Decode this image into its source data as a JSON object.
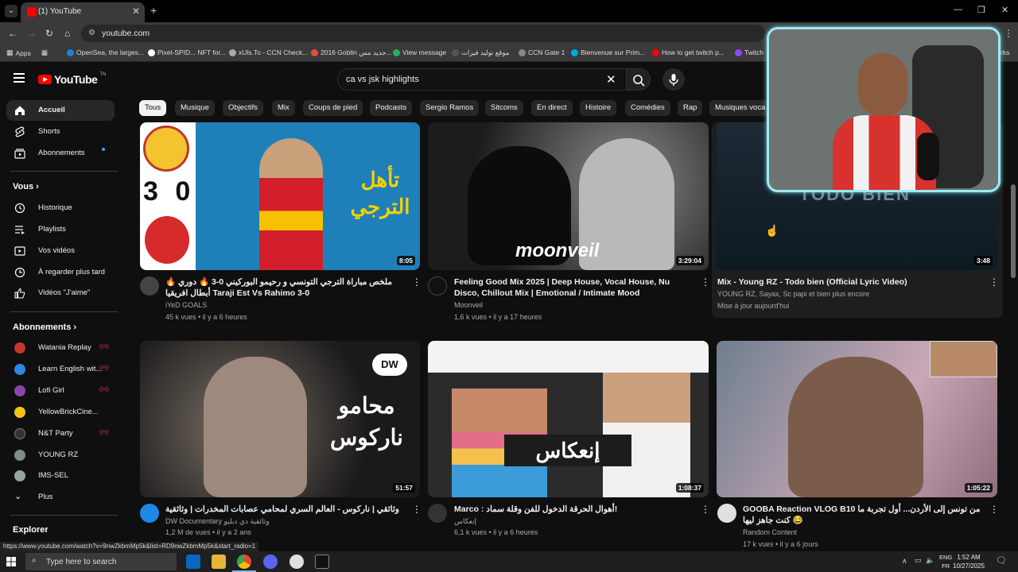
{
  "browser": {
    "tab_title": "(1) YouTube",
    "url": "youtube.com",
    "status_url": "https://www.youtube.com/watch?v=9nwZkbmMp5k&list=RD9nwZkbmMp5k&start_radio=1",
    "bookmarks": [
      "Apps",
      "OpenSea, the larges...",
      "Pixel-SPID... NFT for...",
      "xUls.To - CCN Check...",
      "2016 Goblin جديد مس...",
      "View message",
      "موقع توليد فيزات",
      "CCN Gate 1",
      "Bienvenue sur Prim...",
      "How to get twitch p...",
      "Twitch",
      "rks"
    ]
  },
  "header": {
    "logo_text": "YouTube",
    "logo_sup": "TN",
    "search_value": "ca vs jsk highlights"
  },
  "sidebar": {
    "main": [
      {
        "label": "Accueil",
        "icon": "home-icon"
      },
      {
        "label": "Shorts",
        "icon": "shorts-icon"
      },
      {
        "label": "Abonnements",
        "icon": "subscriptions-icon"
      }
    ],
    "you_heading": "Vous",
    "you": [
      {
        "label": "Historique",
        "icon": "history-icon"
      },
      {
        "label": "Playlists",
        "icon": "playlist-icon"
      },
      {
        "label": "Vos vidéos",
        "icon": "your-videos-icon"
      },
      {
        "label": "À regarder plus tard",
        "icon": "watch-later-icon"
      },
      {
        "label": "Vidéos \"J'aime\"",
        "icon": "like-icon"
      }
    ],
    "subs_heading": "Abonnements",
    "subs": [
      {
        "label": "Watania Replay",
        "color": "#c0392b",
        "live": true
      },
      {
        "label": "Learn English wit...",
        "color": "#2e86de",
        "live": true
      },
      {
        "label": "Lofi Girl",
        "color": "#8e44ad",
        "live": true
      },
      {
        "label": "YellowBrickCine...",
        "color": "#f1c40f",
        "live": false
      },
      {
        "label": "N&T Party",
        "color": "#333333",
        "live": true
      },
      {
        "label": "YOUNG RZ",
        "color": "#7f8c8d",
        "live": false
      },
      {
        "label": "IMS-SEL",
        "color": "#95a5a6",
        "live": false
      }
    ],
    "more_label": "Plus",
    "explore_heading": "Explorer"
  },
  "chips": [
    "Tous",
    "Musique",
    "Objectifs",
    "Mix",
    "Coups de pied",
    "Podcasts",
    "Sergio Ramos",
    "Sitcoms",
    "En direct",
    "Histoire",
    "Comédies",
    "Rap",
    "Musiques voca"
  ],
  "videos": [
    {
      "title": "🔥 ملخص مباراة الترجي التونسي و رحيمو البوركيني 0-3 🔥 دوري أبطال افريقيا Taraji Est Vs Rahimo 3-0",
      "channel": "iYeD GOALS",
      "stats": "45 k vues • il y a 6 heures",
      "duration": "8:05",
      "thumb_text_ar": "تأهل الترجي",
      "score": "3 0"
    },
    {
      "title": "Feeling Good Mix 2025 | Deep House, Vocal House, Nu Disco, Chillout Mix | Emotional / Intimate Mood",
      "channel": "Moonveil",
      "stats": "1,6 k vues • il y a 17 heures",
      "duration": "3:29:04",
      "thumb_text": "moonveil"
    },
    {
      "title": "Mix - Young RZ - Todo bien (Official Lyric Video)",
      "channel": "YOUNG RZ, Sayax, Sc papi et bien plus encore",
      "stats": "Mise à jour aujourd'hui",
      "duration": "3:48",
      "thumb_text": "TODO BIEN"
    },
    {
      "title": "وثائقي | ناركوس - العالم السري لمحامي عصابات المخدرات | وثائقية دي دبليو",
      "channel": "DW Documentary وثائقية دي دبليو",
      "stats": "1,2 M de vues • il y a 2 ans",
      "duration": "51:57",
      "thumb_text_ar": "محامو ناركوس",
      "badge": "DW"
    },
    {
      "title": "Marco : أهوال الحرقة الدخول للفن وقلة سماد!",
      "channel": "إنعكاس",
      "stats": "6,1 k vues • il y a 6 heures",
      "duration": "1:08:37",
      "thumb_text_ar": "إنعكاس"
    },
    {
      "title": "GOOBA Reaction VLOG B10 من تونس إلى الأردن... أول تجربة ما كنت جاهز ليها 😂",
      "channel": "Random Content",
      "stats": "17 k vues • il y a 6 jours",
      "duration": "1:05:22"
    }
  ],
  "taskbar": {
    "search_placeholder": "Type here to search",
    "time": "1:52 AM",
    "date": "10/27/2025",
    "lang1": "ENG",
    "lang2": "FR"
  }
}
